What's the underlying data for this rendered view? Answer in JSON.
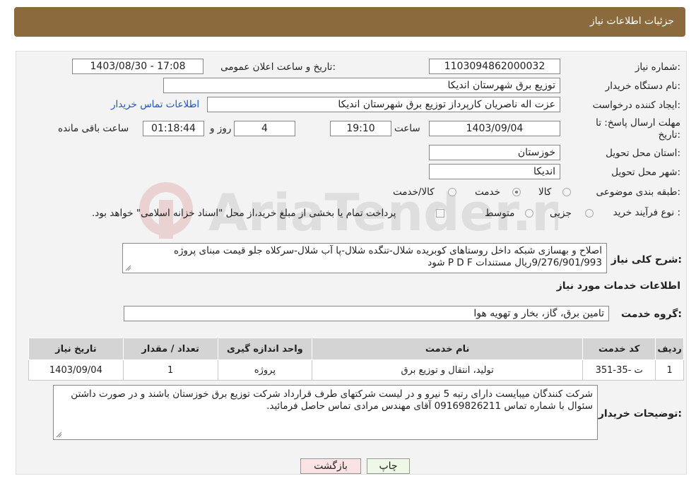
{
  "header": {
    "title": "جزئیات اطلاعات نیاز"
  },
  "labels": {
    "need_number": "شماره نیاز:",
    "announce_datetime": "تاریخ و ساعت اعلان عمومی:",
    "buyer_org": "نام دستگاه خریدار:",
    "requester": "ایجاد کننده درخواست:",
    "deadline": "مهلت ارسال پاسخ: تا",
    "deadline_2": "تاریخ:",
    "time_word": "ساعت",
    "days_word": "روز و",
    "remaining_word": "ساعت باقی مانده",
    "province": "استان محل تحویل:",
    "city": "شهر محل تحویل:",
    "category": "طبقه بندی موضوعی:",
    "purchase_type": "نوع فرآیند خرید :",
    "description": "شرح کلی نیاز:",
    "services_info": "اطلاعات خدمات مورد نیاز",
    "service_group": "گروه خدمت:",
    "buyer_notes": "توضیحات خریدار:"
  },
  "fields": {
    "need_number": "1103094862000032",
    "announce_datetime": "1403/08/30 - 17:08",
    "buyer_org": "توزیع برق شهرستان اندیکا",
    "requester": "عزت اله ناصریان کارپرداز توزیع برق شهرستان اندیکا",
    "contact_link": "اطلاعات تماس خریدار",
    "deadline_date": "1403/09/04",
    "deadline_time": "19:10",
    "days": "4",
    "remaining": "01:18:44",
    "province": "خوزستان",
    "city": "اندیکا",
    "description": "اصلاح و بهسازی  شبکه داخل روستاهای کوبریده شلال-تنگده شلال-پا آب شلال-سرکلاه جلو قیمت مبنای پروژه 9/276/901/993ریال مستندات P D F شود",
    "service_group": "تامین برق، گاز، بخار و تهویه هوا",
    "buyer_notes": "شرکت کنندگان میبایست دارای رتبه 5 نیرو و در لیست شرکتهای طرف قرارداد شرکت توزیع برق خوزستان باشند و در صورت داشتن سئوال با شماره تماس 09169826211  آقای مهندس مرادی تماس حاصل فرمائید."
  },
  "category_options": [
    {
      "label": "کالا",
      "selected": false
    },
    {
      "label": "خدمت",
      "selected": true
    },
    {
      "label": "کالا/خدمت",
      "selected": false
    }
  ],
  "purchase_options": [
    {
      "label": "جزیی",
      "selected": false
    },
    {
      "label": "متوسط",
      "selected": false
    }
  ],
  "purchase_note": "پرداخت تمام یا بخشی از مبلغ خرید،از محل \"اسناد خزانه اسلامی\" خواهد بود.",
  "table": {
    "headers": [
      "ردیف",
      "کد خدمت",
      "نام خدمت",
      "واحد اندازه گیری",
      "تعداد / مقدار",
      "تاریخ نیاز"
    ],
    "rows": [
      [
        "1",
        "ت -35-351",
        "تولید، انتقال و توزیع برق",
        "پروژه",
        "1",
        "1403/09/04"
      ]
    ]
  },
  "buttons": {
    "print": "چاپ",
    "back": "بازگشت"
  },
  "watermark": "AriaTender.neT"
}
